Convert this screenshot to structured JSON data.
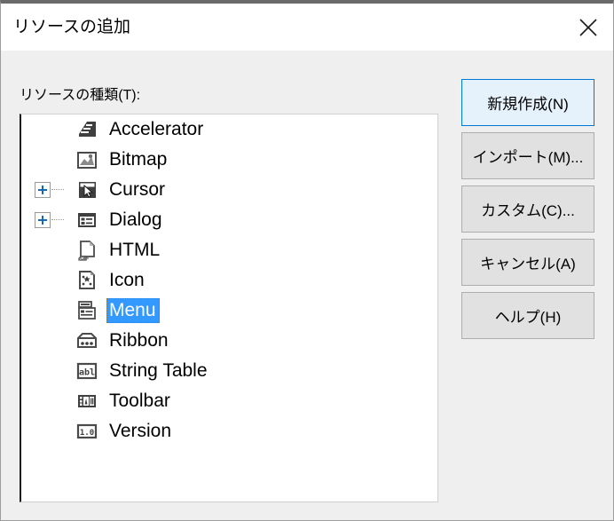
{
  "window": {
    "title": "リソースの追加",
    "close_icon": "close-icon"
  },
  "form": {
    "list_label": "リソースの種類(T):"
  },
  "colors": {
    "dialog_background": "#efefef",
    "titlebar_background": "#ffffff",
    "selection_blue": "#3399ff",
    "default_button_border": "#0078d7",
    "default_button_fill": "#e5f1fb",
    "expander_plus": "#1668b8"
  },
  "tree": {
    "items": [
      {
        "label": "Accelerator",
        "icon": "accelerator-icon",
        "expandable": false,
        "selected": false
      },
      {
        "label": "Bitmap",
        "icon": "bitmap-icon",
        "expandable": false,
        "selected": false
      },
      {
        "label": "Cursor",
        "icon": "cursor-icon",
        "expandable": true,
        "selected": false
      },
      {
        "label": "Dialog",
        "icon": "dialog-icon",
        "expandable": true,
        "selected": false
      },
      {
        "label": "HTML",
        "icon": "html-icon",
        "expandable": false,
        "selected": false
      },
      {
        "label": "Icon",
        "icon": "icon-icon",
        "expandable": false,
        "selected": false
      },
      {
        "label": "Menu",
        "icon": "menu-icon",
        "expandable": false,
        "selected": true
      },
      {
        "label": "Ribbon",
        "icon": "ribbon-icon",
        "expandable": false,
        "selected": false
      },
      {
        "label": "String Table",
        "icon": "string-table-icon",
        "expandable": false,
        "selected": false
      },
      {
        "label": "Toolbar",
        "icon": "toolbar-icon",
        "expandable": false,
        "selected": false
      },
      {
        "label": "Version",
        "icon": "version-icon",
        "expandable": false,
        "selected": false
      }
    ]
  },
  "buttons": [
    {
      "label": "新規作成(N)",
      "default": true
    },
    {
      "label": "インポート(M)...",
      "default": false
    },
    {
      "label": "カスタム(C)...",
      "default": false
    },
    {
      "label": "キャンセル(A)",
      "default": false
    },
    {
      "label": "ヘルプ(H)",
      "default": false
    }
  ]
}
